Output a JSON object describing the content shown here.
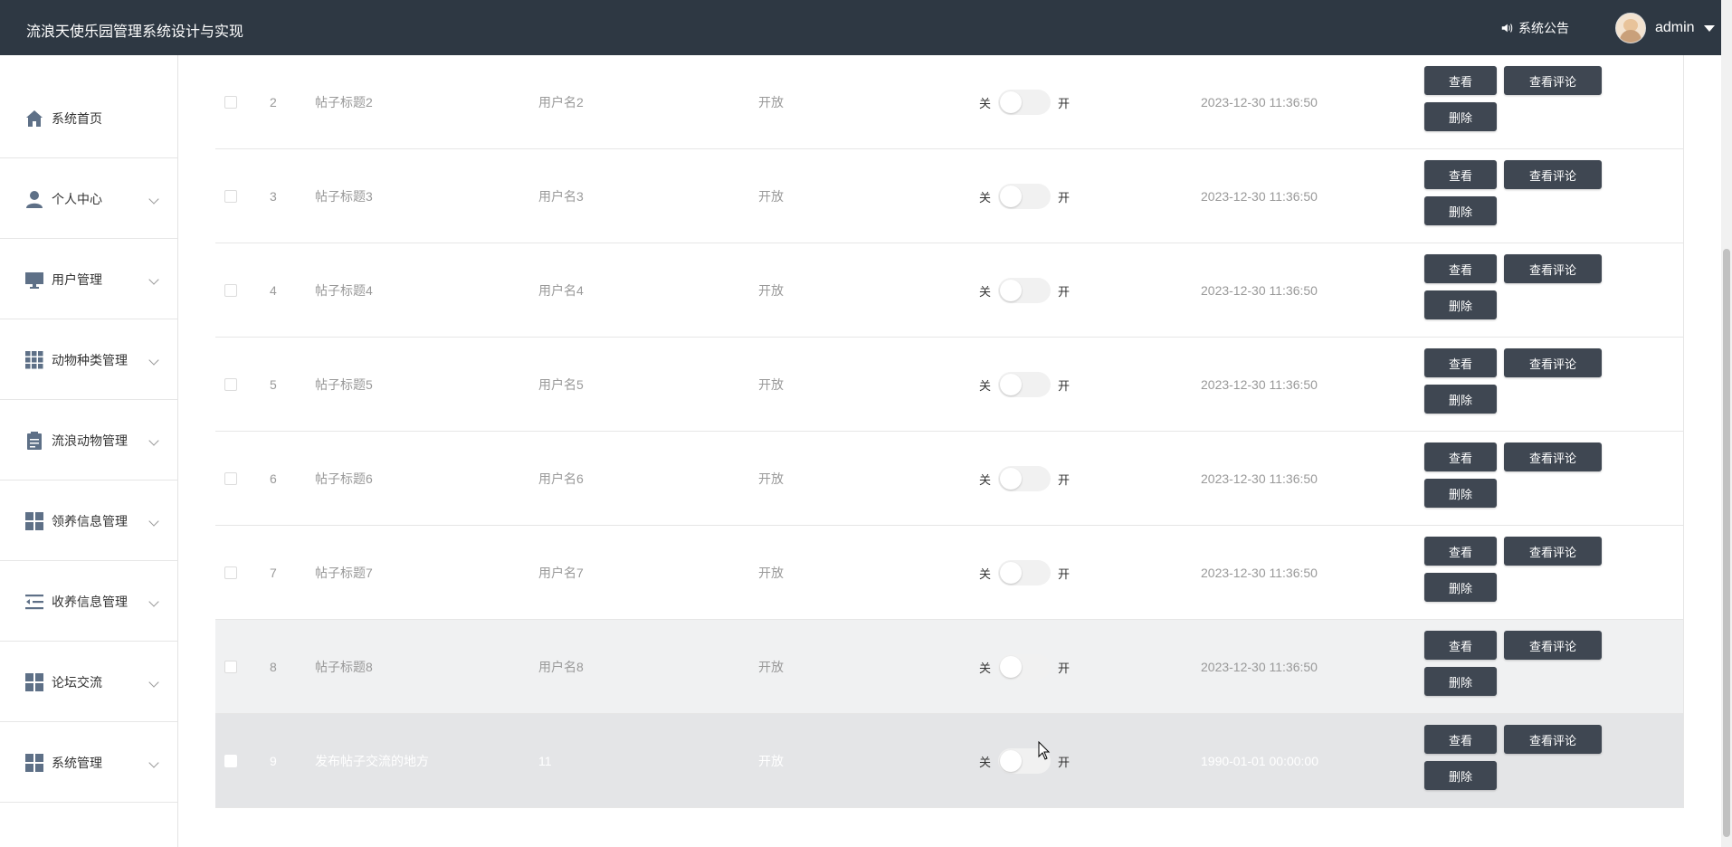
{
  "header": {
    "app_title": "流浪天使乐园管理系统设计与实现",
    "notice_label": "系统公告",
    "username": "admin"
  },
  "sidebar": {
    "items": [
      {
        "label": "系统首页",
        "icon": "home-icon",
        "has_chevron": false
      },
      {
        "label": "个人中心",
        "icon": "person-icon",
        "has_chevron": true
      },
      {
        "label": "用户管理",
        "icon": "monitor-icon",
        "has_chevron": true
      },
      {
        "label": "动物种类管理",
        "icon": "grid-icon",
        "has_chevron": true
      },
      {
        "label": "流浪动物管理",
        "icon": "clipboard-icon",
        "has_chevron": true
      },
      {
        "label": "领养信息管理",
        "icon": "apps-icon",
        "has_chevron": true
      },
      {
        "label": "收养信息管理",
        "icon": "list-indent-icon",
        "has_chevron": true
      },
      {
        "label": "论坛交流",
        "icon": "apps-icon",
        "has_chevron": true
      },
      {
        "label": "系统管理",
        "icon": "apps-icon",
        "has_chevron": true
      }
    ]
  },
  "table": {
    "toggle_off_label": "关",
    "toggle_on_label": "开",
    "buttons": {
      "view": "查看",
      "comments": "查看评论",
      "delete": "删除"
    },
    "rows": [
      {
        "index": "2",
        "title": "帖子标题2",
        "username": "用户名2",
        "status": "开放",
        "time": "2023-12-30 11:36:50",
        "state": "normal"
      },
      {
        "index": "3",
        "title": "帖子标题3",
        "username": "用户名3",
        "status": "开放",
        "time": "2023-12-30 11:36:50",
        "state": "normal"
      },
      {
        "index": "4",
        "title": "帖子标题4",
        "username": "用户名4",
        "status": "开放",
        "time": "2023-12-30 11:36:50",
        "state": "normal"
      },
      {
        "index": "5",
        "title": "帖子标题5",
        "username": "用户名5",
        "status": "开放",
        "time": "2023-12-30 11:36:50",
        "state": "normal"
      },
      {
        "index": "6",
        "title": "帖子标题6",
        "username": "用户名6",
        "status": "开放",
        "time": "2023-12-30 11:36:50",
        "state": "normal"
      },
      {
        "index": "7",
        "title": "帖子标题7",
        "username": "用户名7",
        "status": "开放",
        "time": "2023-12-30 11:36:50",
        "state": "normal"
      },
      {
        "index": "8",
        "title": "帖子标题8",
        "username": "用户名8",
        "status": "开放",
        "time": "2023-12-30 11:36:50",
        "state": "hover"
      },
      {
        "index": "9",
        "title": "发布帖子交流的地方",
        "username": "11",
        "status": "开放",
        "time": "1990-01-01 00:00:00",
        "state": "selected"
      }
    ]
  },
  "colors": {
    "header_bg": "#2e3843",
    "button_bg": "#3f4752",
    "icon_color": "#5e7087"
  }
}
